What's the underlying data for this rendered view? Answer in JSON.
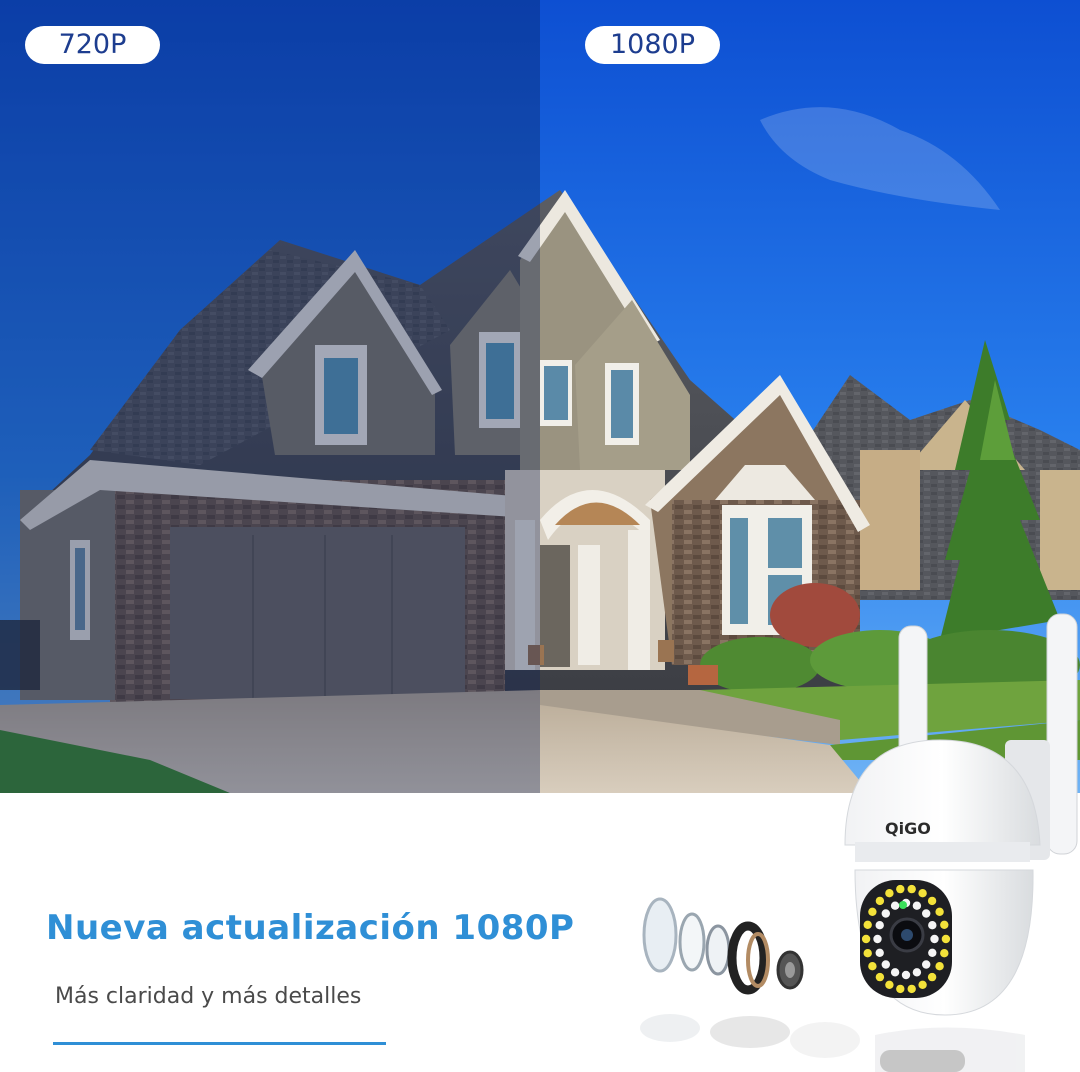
{
  "resolution_labels": {
    "low": "720P",
    "high": "1080P"
  },
  "headline": "Nueva actualización 1080P",
  "subheadline": "Más claridad y más detalles",
  "camera": {
    "brand": "QiGO"
  },
  "colors": {
    "accent_blue": "#2f8fd6",
    "pill_text": "#1d3d8f",
    "sky_blue": "#1a6ee0",
    "sky_dark_overlay": "#0a1c55"
  }
}
